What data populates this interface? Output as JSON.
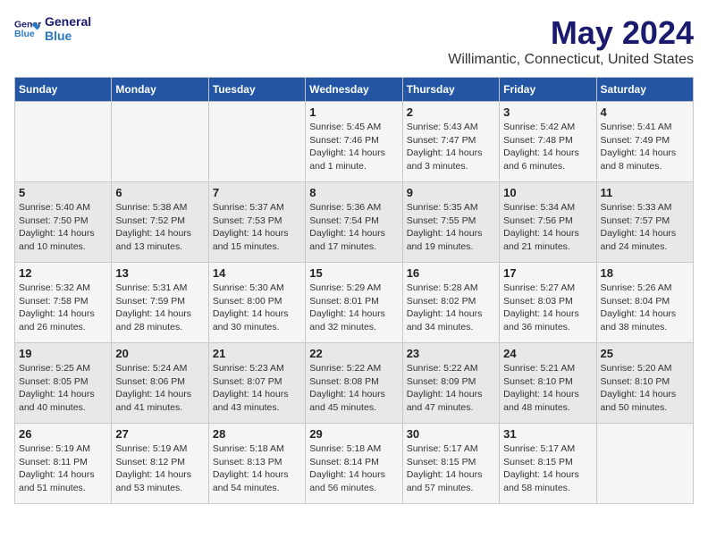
{
  "header": {
    "logo_line1": "General",
    "logo_line2": "Blue",
    "title": "May 2024",
    "subtitle": "Willimantic, Connecticut, United States"
  },
  "days_of_week": [
    "Sunday",
    "Monday",
    "Tuesday",
    "Wednesday",
    "Thursday",
    "Friday",
    "Saturday"
  ],
  "weeks": [
    [
      {
        "day": "",
        "info": ""
      },
      {
        "day": "",
        "info": ""
      },
      {
        "day": "",
        "info": ""
      },
      {
        "day": "1",
        "info": "Sunrise: 5:45 AM\nSunset: 7:46 PM\nDaylight: 14 hours\nand 1 minute."
      },
      {
        "day": "2",
        "info": "Sunrise: 5:43 AM\nSunset: 7:47 PM\nDaylight: 14 hours\nand 3 minutes."
      },
      {
        "day": "3",
        "info": "Sunrise: 5:42 AM\nSunset: 7:48 PM\nDaylight: 14 hours\nand 6 minutes."
      },
      {
        "day": "4",
        "info": "Sunrise: 5:41 AM\nSunset: 7:49 PM\nDaylight: 14 hours\nand 8 minutes."
      }
    ],
    [
      {
        "day": "5",
        "info": "Sunrise: 5:40 AM\nSunset: 7:50 PM\nDaylight: 14 hours\nand 10 minutes."
      },
      {
        "day": "6",
        "info": "Sunrise: 5:38 AM\nSunset: 7:52 PM\nDaylight: 14 hours\nand 13 minutes."
      },
      {
        "day": "7",
        "info": "Sunrise: 5:37 AM\nSunset: 7:53 PM\nDaylight: 14 hours\nand 15 minutes."
      },
      {
        "day": "8",
        "info": "Sunrise: 5:36 AM\nSunset: 7:54 PM\nDaylight: 14 hours\nand 17 minutes."
      },
      {
        "day": "9",
        "info": "Sunrise: 5:35 AM\nSunset: 7:55 PM\nDaylight: 14 hours\nand 19 minutes."
      },
      {
        "day": "10",
        "info": "Sunrise: 5:34 AM\nSunset: 7:56 PM\nDaylight: 14 hours\nand 21 minutes."
      },
      {
        "day": "11",
        "info": "Sunrise: 5:33 AM\nSunset: 7:57 PM\nDaylight: 14 hours\nand 24 minutes."
      }
    ],
    [
      {
        "day": "12",
        "info": "Sunrise: 5:32 AM\nSunset: 7:58 PM\nDaylight: 14 hours\nand 26 minutes."
      },
      {
        "day": "13",
        "info": "Sunrise: 5:31 AM\nSunset: 7:59 PM\nDaylight: 14 hours\nand 28 minutes."
      },
      {
        "day": "14",
        "info": "Sunrise: 5:30 AM\nSunset: 8:00 PM\nDaylight: 14 hours\nand 30 minutes."
      },
      {
        "day": "15",
        "info": "Sunrise: 5:29 AM\nSunset: 8:01 PM\nDaylight: 14 hours\nand 32 minutes."
      },
      {
        "day": "16",
        "info": "Sunrise: 5:28 AM\nSunset: 8:02 PM\nDaylight: 14 hours\nand 34 minutes."
      },
      {
        "day": "17",
        "info": "Sunrise: 5:27 AM\nSunset: 8:03 PM\nDaylight: 14 hours\nand 36 minutes."
      },
      {
        "day": "18",
        "info": "Sunrise: 5:26 AM\nSunset: 8:04 PM\nDaylight: 14 hours\nand 38 minutes."
      }
    ],
    [
      {
        "day": "19",
        "info": "Sunrise: 5:25 AM\nSunset: 8:05 PM\nDaylight: 14 hours\nand 40 minutes."
      },
      {
        "day": "20",
        "info": "Sunrise: 5:24 AM\nSunset: 8:06 PM\nDaylight: 14 hours\nand 41 minutes."
      },
      {
        "day": "21",
        "info": "Sunrise: 5:23 AM\nSunset: 8:07 PM\nDaylight: 14 hours\nand 43 minutes."
      },
      {
        "day": "22",
        "info": "Sunrise: 5:22 AM\nSunset: 8:08 PM\nDaylight: 14 hours\nand 45 minutes."
      },
      {
        "day": "23",
        "info": "Sunrise: 5:22 AM\nSunset: 8:09 PM\nDaylight: 14 hours\nand 47 minutes."
      },
      {
        "day": "24",
        "info": "Sunrise: 5:21 AM\nSunset: 8:10 PM\nDaylight: 14 hours\nand 48 minutes."
      },
      {
        "day": "25",
        "info": "Sunrise: 5:20 AM\nSunset: 8:10 PM\nDaylight: 14 hours\nand 50 minutes."
      }
    ],
    [
      {
        "day": "26",
        "info": "Sunrise: 5:19 AM\nSunset: 8:11 PM\nDaylight: 14 hours\nand 51 minutes."
      },
      {
        "day": "27",
        "info": "Sunrise: 5:19 AM\nSunset: 8:12 PM\nDaylight: 14 hours\nand 53 minutes."
      },
      {
        "day": "28",
        "info": "Sunrise: 5:18 AM\nSunset: 8:13 PM\nDaylight: 14 hours\nand 54 minutes."
      },
      {
        "day": "29",
        "info": "Sunrise: 5:18 AM\nSunset: 8:14 PM\nDaylight: 14 hours\nand 56 minutes."
      },
      {
        "day": "30",
        "info": "Sunrise: 5:17 AM\nSunset: 8:15 PM\nDaylight: 14 hours\nand 57 minutes."
      },
      {
        "day": "31",
        "info": "Sunrise: 5:17 AM\nSunset: 8:15 PM\nDaylight: 14 hours\nand 58 minutes."
      },
      {
        "day": "",
        "info": ""
      }
    ]
  ]
}
